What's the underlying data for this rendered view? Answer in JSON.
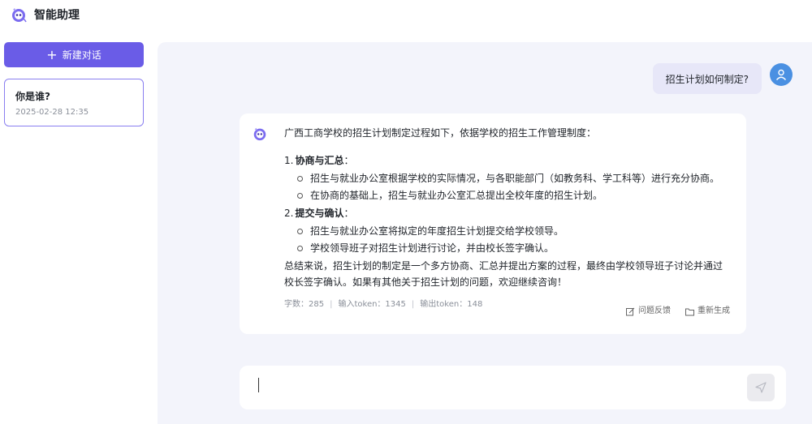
{
  "app": {
    "title": "智能助理",
    "logo_icon": "assistant-logo-icon"
  },
  "sidebar": {
    "new_chat_label": "新建对话",
    "history": [
      {
        "title": "你是谁?",
        "time": "2025-02-28 12:35"
      }
    ]
  },
  "chat": {
    "user_message": "招生计划如何制定?",
    "bot": {
      "intro": "广西工商学校的招生计划制定过程如下，依据学校的招生工作管理制度：",
      "steps": [
        {
          "num": "1.",
          "title": "协商与汇总",
          "colon": "：",
          "items": [
            "招生与就业办公室根据学校的实际情况，与各职能部门（如教务科、学工科等）进行充分协商。",
            "在协商的基础上，招生与就业办公室汇总提出全校年度的招生计划。"
          ]
        },
        {
          "num": "2.",
          "title": "提交与确认",
          "colon": "：",
          "items": [
            "招生与就业办公室将拟定的年度招生计划提交给学校领导。",
            "学校领导班子对招生计划进行讨论，并由校长签字确认。"
          ]
        }
      ],
      "summary": "总结来说，招生计划的制定是一个多方协商、汇总并提出方案的过程，最终由学校领导班子讨论并通过校长签字确认。如果有其他关于招生计划的问题，欢迎继续咨询！",
      "stats": {
        "chars": "字数：285",
        "input_tokens": "输入token：1345",
        "output_tokens": "输出token：148"
      },
      "actions": {
        "feedback": "问题反馈",
        "regenerate": "重新生成"
      }
    }
  },
  "input": {
    "placeholder": "",
    "value": ""
  },
  "colors": {
    "primary": "#6a5ce7",
    "user_bubble": "#e7e7f8",
    "main_bg": "#f3f4fb",
    "avatar": "#4a90e2"
  }
}
